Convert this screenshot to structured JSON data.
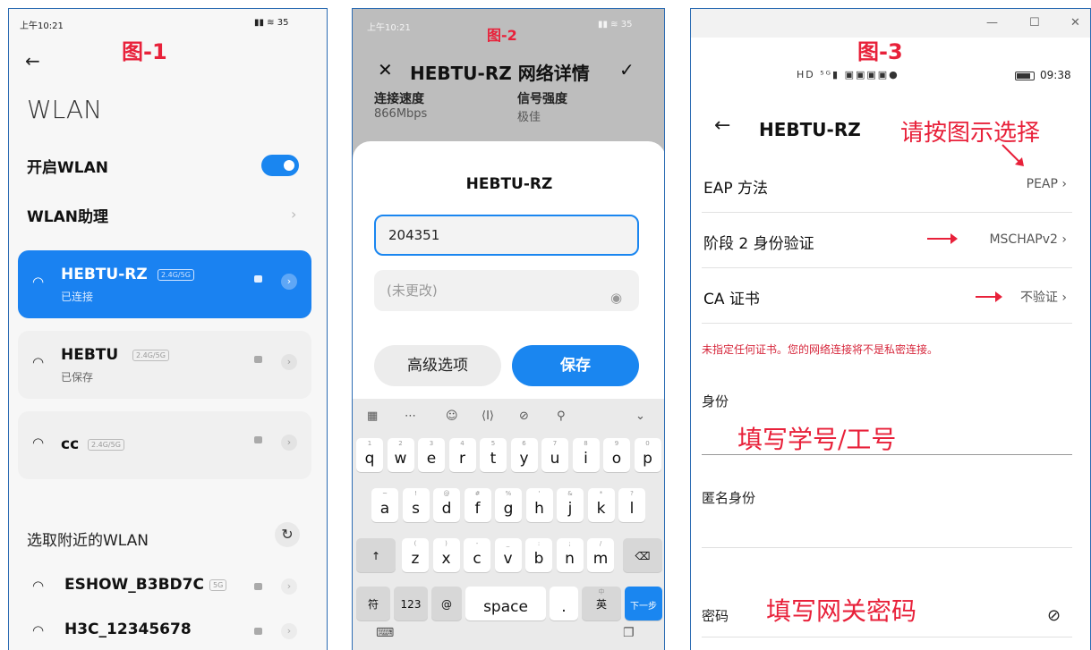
{
  "phone1": {
    "status_time": "上午10:21",
    "status_icons": "▮▮ ≋ 35",
    "figure_label": "图-1",
    "title": "WLAN",
    "enable_label": "开启WLAN",
    "assistant_label": "WLAN助理",
    "saved_networks": [
      {
        "ssid": "HEBTU-RZ",
        "band": "2.4G/5G",
        "status": "已连接"
      },
      {
        "ssid": "HEBTU",
        "band": "2.4G/5G",
        "status": "已保存"
      },
      {
        "ssid": "cc",
        "band": "2.4G/5G",
        "status": ""
      }
    ],
    "nearby_label": "选取附近的WLAN",
    "nearby_networks": [
      {
        "ssid": "ESHOW_B3BD7C",
        "band": "5G"
      },
      {
        "ssid": "H3C_12345678",
        "band": ""
      }
    ]
  },
  "phone2": {
    "status_time": "上午10:21",
    "status_icons": "▮▮ ≋ 35",
    "figure_label": "图-2",
    "header_title": "HEBTU-RZ 网络详情",
    "stats": [
      {
        "label": "连接速度",
        "value": "866Mbps"
      },
      {
        "label": "信号强度",
        "value": "极佳"
      }
    ],
    "dialog": {
      "title": "HEBTU-RZ",
      "identity_value": "204351",
      "password_placeholder": "(未更改)",
      "advanced_label": "高级选项",
      "save_label": "保存"
    },
    "keyboard": {
      "row1": [
        {
          "sup": "1",
          "ch": "q"
        },
        {
          "sup": "2",
          "ch": "w"
        },
        {
          "sup": "3",
          "ch": "e"
        },
        {
          "sup": "4",
          "ch": "r"
        },
        {
          "sup": "5",
          "ch": "t"
        },
        {
          "sup": "6",
          "ch": "y"
        },
        {
          "sup": "7",
          "ch": "u"
        },
        {
          "sup": "8",
          "ch": "i"
        },
        {
          "sup": "9",
          "ch": "o"
        },
        {
          "sup": "0",
          "ch": "p"
        }
      ],
      "row2": [
        {
          "sup": "~",
          "ch": "a"
        },
        {
          "sup": "!",
          "ch": "s"
        },
        {
          "sup": "@",
          "ch": "d"
        },
        {
          "sup": "#",
          "ch": "f"
        },
        {
          "sup": "%",
          "ch": "g"
        },
        {
          "sup": "'",
          "ch": "h"
        },
        {
          "sup": "&",
          "ch": "j"
        },
        {
          "sup": "*",
          "ch": "k"
        },
        {
          "sup": "?",
          "ch": "l"
        }
      ],
      "row3": [
        {
          "sup": "(",
          "ch": "z"
        },
        {
          "sup": ")",
          "ch": "x"
        },
        {
          "sup": "-",
          "ch": "c"
        },
        {
          "sup": "_",
          "ch": "v"
        },
        {
          "sup": ":",
          "ch": "b"
        },
        {
          "sup": ";",
          "ch": "n"
        },
        {
          "sup": "/",
          "ch": "m"
        }
      ],
      "sym_label": "符",
      "num_label": "123",
      "at_label": "@",
      "space_label": "space",
      "period_label": ".",
      "lang_label": "英",
      "lang_sup": "中",
      "go_label": "下一步"
    }
  },
  "phone3": {
    "window_controls": [
      "—",
      "☐",
      "✕"
    ],
    "figure_label": "图-3",
    "status_icons": "HD ⁵ᴳ▮ ▣▣▣▣●",
    "status_time": "09:38",
    "network_title": "HEBTU-RZ",
    "instruction_note": "请按图示选择",
    "options": [
      {
        "label": "EAP 方法",
        "value": "PEAP"
      },
      {
        "label": "阶段 2 身份验证",
        "value": "MSCHAPv2"
      },
      {
        "label": "CA 证书",
        "value": "不验证"
      }
    ],
    "warning": "未指定任何证书。您的网络连接将不是私密连接。",
    "identity_label": "身份",
    "identity_note": "填写学号/工号",
    "anonymous_label": "匿名身份",
    "password_label": "密码",
    "password_note": "填写网关密码"
  }
}
